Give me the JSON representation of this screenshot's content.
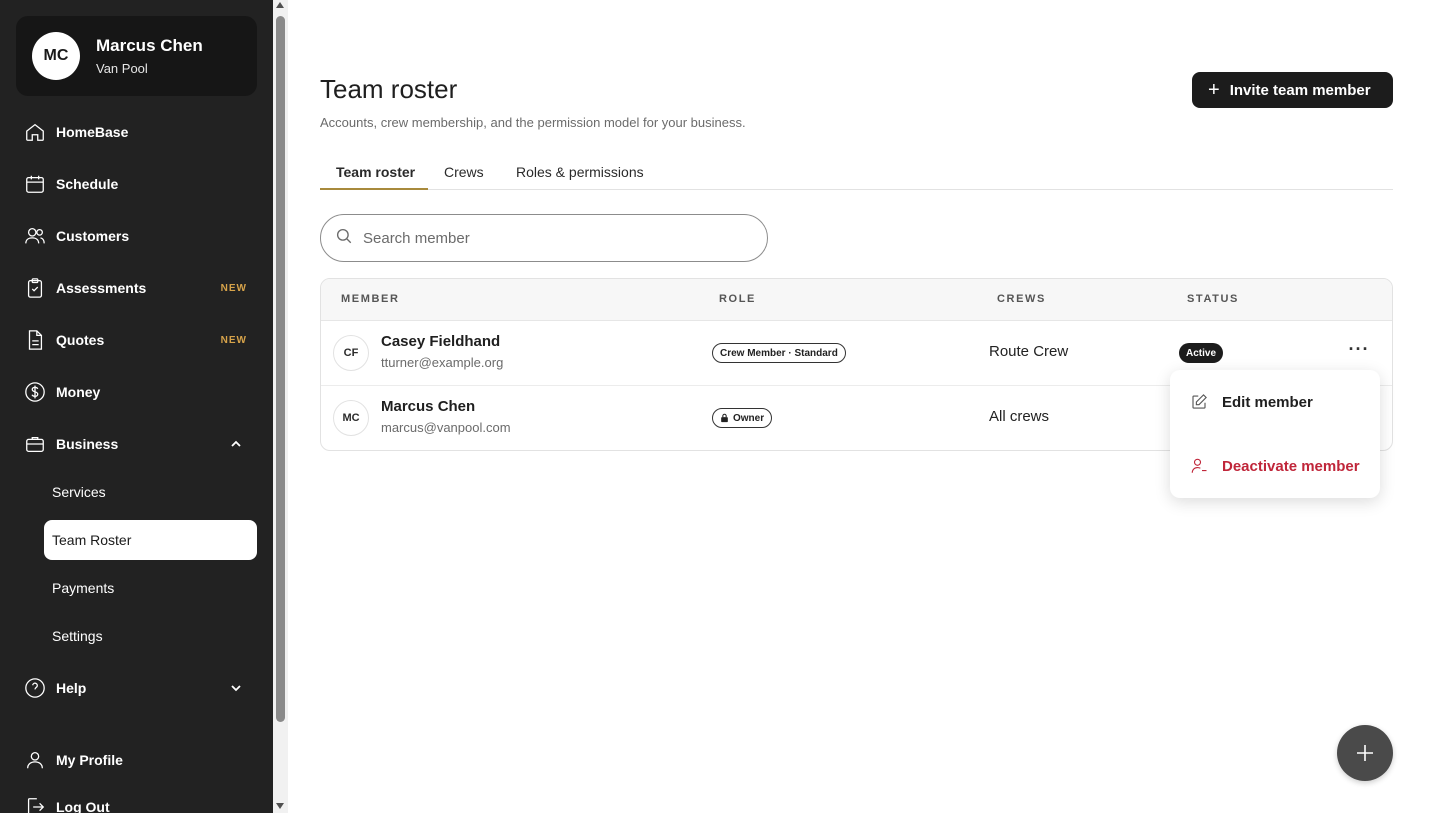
{
  "sidebar": {
    "profile": {
      "initials": "MC",
      "name": "Marcus Chen",
      "org": "Van Pool"
    },
    "nav": [
      {
        "label": "HomeBase",
        "icon": "home-icon"
      },
      {
        "label": "Schedule",
        "icon": "calendar-icon"
      },
      {
        "label": "Customers",
        "icon": "users-icon"
      },
      {
        "label": "Assessments",
        "icon": "clipboard-check-icon",
        "badge": "NEW"
      },
      {
        "label": "Quotes",
        "icon": "document-icon",
        "badge": "NEW"
      },
      {
        "label": "Money",
        "icon": "dollar-circle-icon"
      },
      {
        "label": "Business",
        "icon": "briefcase-icon",
        "expanded": true
      },
      {
        "label": "Help",
        "icon": "help-circle-icon",
        "expanded": false
      },
      {
        "label": "My Profile",
        "icon": "user-icon"
      },
      {
        "label": "Log Out",
        "icon": "logout-icon"
      }
    ],
    "business_sub": [
      {
        "label": "Services"
      },
      {
        "label": "Team Roster",
        "active": true
      },
      {
        "label": "Payments"
      },
      {
        "label": "Settings"
      }
    ]
  },
  "header": {
    "title": "Team roster",
    "subtitle": "Accounts, crew membership, and the permission model for your business.",
    "invite_label": "Invite team member"
  },
  "tabs": [
    {
      "label": "Team roster",
      "active": true
    },
    {
      "label": "Crews"
    },
    {
      "label": "Roles & permissions"
    }
  ],
  "search": {
    "placeholder": "Search member",
    "value": ""
  },
  "table": {
    "columns": [
      "MEMBER",
      "ROLE",
      "CREWS",
      "STATUS"
    ],
    "rows": [
      {
        "initials": "CF",
        "name": "Casey Fieldhand",
        "email": "tturner@example.org",
        "role": "Crew Member · Standard",
        "crews": "Route Crew",
        "status": "Active",
        "more": "···"
      },
      {
        "initials": "MC",
        "name": "Marcus Chen",
        "email": "marcus@vanpool.com",
        "role": "Owner",
        "crews": "All crews"
      }
    ]
  },
  "row_menu": {
    "items": [
      {
        "label": "Edit member",
        "icon": "edit-icon"
      },
      {
        "label": "Deactivate member",
        "icon": "user-minus-icon",
        "danger": true
      }
    ]
  },
  "colors": {
    "accent_tab": "#a88a3c",
    "badge_new": "#d7a34a",
    "danger": "#c0263a",
    "sidebar_bg": "#222222"
  }
}
